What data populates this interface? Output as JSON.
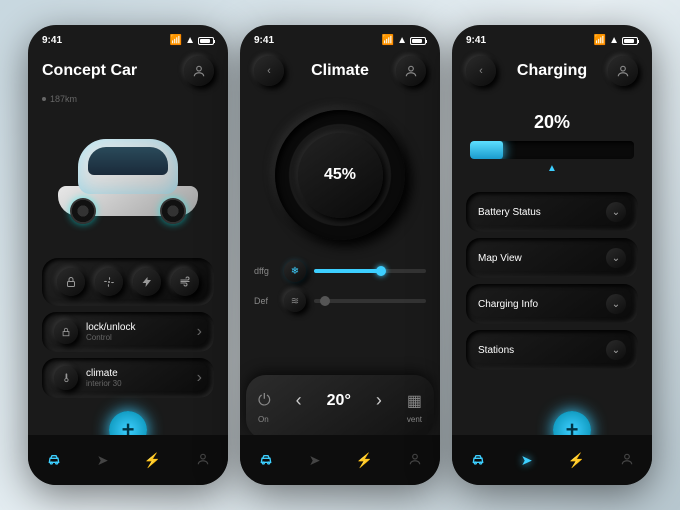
{
  "status": {
    "time": "9:41"
  },
  "colors": {
    "accent": "#3dcfff"
  },
  "home": {
    "title": "Concept Car",
    "range": "187km",
    "quick": [
      "lock-icon",
      "fan-icon",
      "bolt-icon",
      "airflow-icon"
    ],
    "items": [
      {
        "label": "lock/unlock",
        "sub": "Control"
      },
      {
        "label": "climate",
        "sub": "interior 30"
      }
    ]
  },
  "climate": {
    "title": "Climate",
    "percent": "45%",
    "rows": [
      {
        "label": "dffg",
        "icon": "snowflake-icon",
        "active": true,
        "value": 60
      },
      {
        "label": "Def",
        "icon": "defrost-icon",
        "active": false,
        "value": 10
      }
    ],
    "panel": {
      "temp": "20°",
      "left_label": "On",
      "right_label": "vent"
    }
  },
  "charging": {
    "title": "Charging",
    "percent": "20%",
    "percent_val": 20,
    "sections": [
      "Battery Status",
      "Map View",
      "Charging Info",
      "Stations"
    ]
  },
  "nav": [
    "car-icon",
    "compass-icon",
    "bolt-icon",
    "user-icon"
  ]
}
